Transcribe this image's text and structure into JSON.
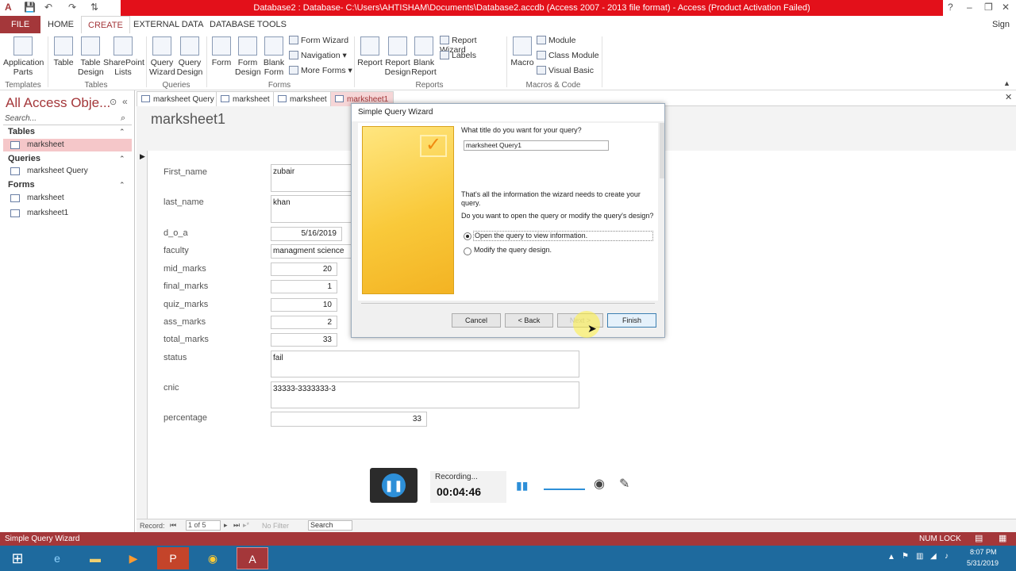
{
  "window": {
    "title": "Database2 : Database- C:\\Users\\AHTISHAM\\Documents\\Database2.accdb (Access 2007 - 2013 file format) - Access (Product Activation Failed)",
    "help": "?",
    "sign_in": "Sign in"
  },
  "ribbon_tabs": [
    "FILE",
    "HOME",
    "CREATE",
    "EXTERNAL DATA",
    "DATABASE TOOLS"
  ],
  "ribbon": {
    "templates": {
      "app_parts": "Application Parts",
      "group": "Templates"
    },
    "tables": {
      "table": "Table",
      "table_design": "Table Design",
      "sharepoint_lists": "SharePoint Lists",
      "group": "Tables"
    },
    "queries": {
      "query_wizard": "Query Wizard",
      "query_design": "Query Design",
      "group": "Queries"
    },
    "forms": {
      "form": "Form",
      "form_design": "Form Design",
      "blank_form": "Blank Form",
      "form_wizard": "Form Wizard",
      "navigation": "Navigation",
      "more_forms": "More Forms",
      "group": "Forms"
    },
    "reports": {
      "report": "Report",
      "report_design": "Report Design",
      "blank_report": "Blank Report",
      "report_wizard": "Report Wizard",
      "labels": "Labels",
      "group": "Reports"
    },
    "macros": {
      "macro": "Macro",
      "module": "Module",
      "class_module": "Class Module",
      "visual_basic": "Visual Basic",
      "group": "Macros & Code"
    }
  },
  "nav_pane": {
    "title": "All Access Obje...",
    "search_placeholder": "Search...",
    "sections": [
      {
        "label": "Tables",
        "items": [
          "marksheet"
        ]
      },
      {
        "label": "Queries",
        "items": [
          "marksheet Query"
        ]
      },
      {
        "label": "Forms",
        "items": [
          "marksheet",
          "marksheet1"
        ]
      }
    ]
  },
  "doc_tabs": [
    "marksheet Query",
    "marksheet",
    "marksheet",
    "marksheet1"
  ],
  "form": {
    "title": "marksheet1",
    "fields": [
      {
        "label": "First_name",
        "value": "zubair"
      },
      {
        "label": "last_name",
        "value": "khan"
      },
      {
        "label": "d_o_a",
        "value": "5/16/2019"
      },
      {
        "label": "faculty",
        "value": "managment science"
      },
      {
        "label": "mid_marks",
        "value": "20"
      },
      {
        "label": "final_marks",
        "value": "1"
      },
      {
        "label": "quiz_marks",
        "value": "10"
      },
      {
        "label": "ass_marks",
        "value": "2"
      },
      {
        "label": "total_marks",
        "value": "33"
      },
      {
        "label": "status",
        "value": "fail"
      },
      {
        "label": "cnic",
        "value": "33333-3333333-3"
      },
      {
        "label": "percentage",
        "value": "33"
      }
    ]
  },
  "record_nav": {
    "label": "Record:",
    "position": "1 of 5",
    "filter": "No Filter",
    "search": "Search"
  },
  "dialog": {
    "caption": "Simple Query Wizard",
    "question": "What title do you want for your query?",
    "title_value": "marksheet Query1",
    "info1": "That's all the information the wizard needs to create your query.",
    "info2": "Do you want to open the query or modify the query's design?",
    "option_open": "Open the query to view information.",
    "option_modify": "Modify the query design.",
    "selected_option": "open",
    "buttons": {
      "cancel": "Cancel",
      "back": "< Back",
      "next": "Next >",
      "finish": "Finish"
    }
  },
  "recorder": {
    "status": "Recording...",
    "time": "00:04:46"
  },
  "status_bar": {
    "left": "Simple Query Wizard",
    "right": "NUM LOCK"
  },
  "taskbar": {
    "time": "8:07 PM",
    "date": "5/31/2019"
  }
}
